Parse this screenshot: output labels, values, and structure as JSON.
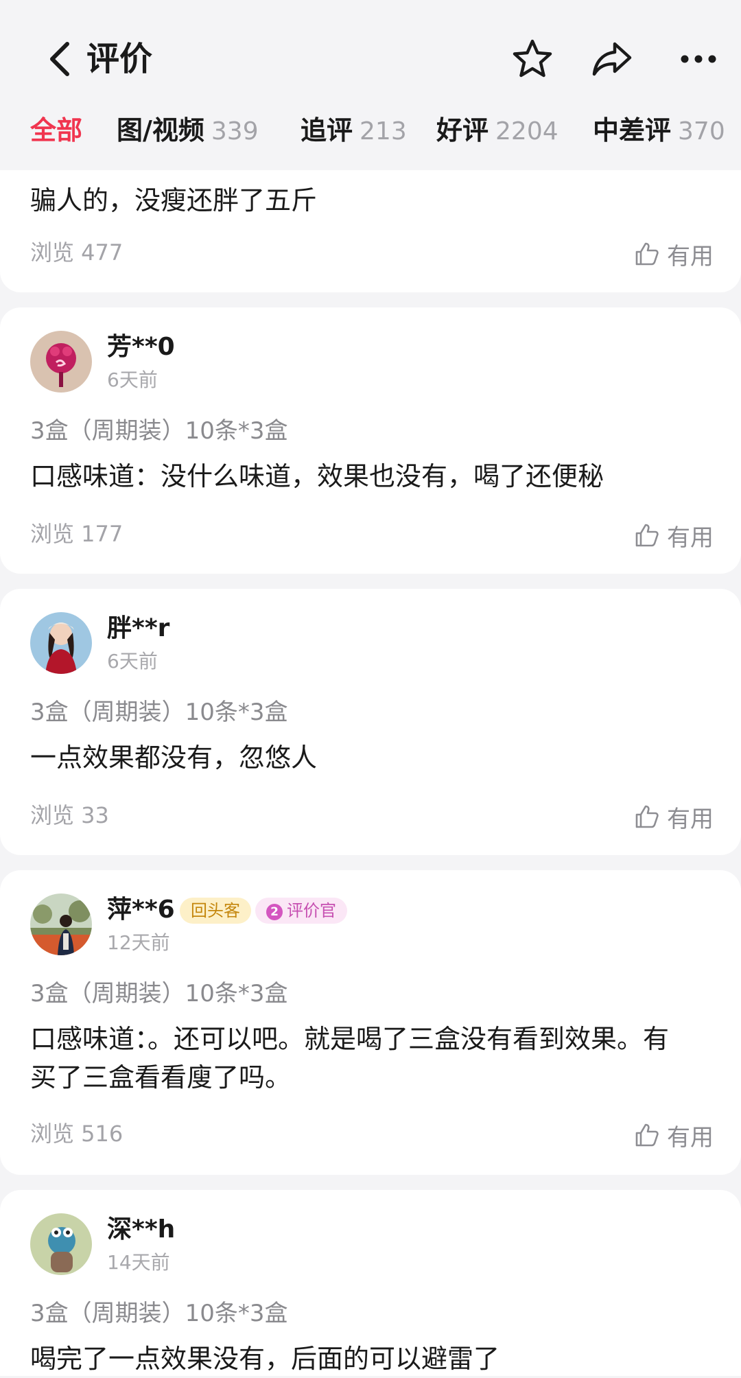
{
  "header": {
    "title": "评价",
    "icons": [
      "back-icon",
      "star-icon",
      "share-icon",
      "more-icon"
    ]
  },
  "tabs": [
    {
      "label": "全部",
      "count": ""
    },
    {
      "label": "图/视频",
      "count": "339"
    },
    {
      "label": "追评",
      "count": "213"
    },
    {
      "label": "好评",
      "count": "2204"
    },
    {
      "label": "中差评",
      "count": "370"
    }
  ],
  "colors": {
    "accent": "#f0354f",
    "background": "#f4f4f6"
  },
  "reviews": [
    {
      "content": "骗人的，没瘦还胖了五斤",
      "views": "浏览 477",
      "useful": "有用"
    },
    {
      "user": "芳**0",
      "time": "6天前",
      "sku": "3盒（周期装）10条*3盒",
      "content": "口感味道：没什么味道，效果也没有，喝了还便秘",
      "views": "浏览 177",
      "useful": "有用"
    },
    {
      "user": "胖**r",
      "time": "6天前",
      "sku": "3盒（周期装）10条*3盒",
      "content": "一点效果都没有，忽悠人",
      "views": "浏览 33",
      "useful": "有用"
    },
    {
      "user": "萍**6",
      "badges": {
        "returning": "回头客",
        "reviewer_level": "2",
        "reviewer": "评价官"
      },
      "time": "12天前",
      "sku": "3盒（周期装）10条*3盒",
      "content_line1": "口感味道：。还可以吧。就是喝了三盒没有看到效果。有",
      "content_line2": "买了三盒看看廋了吗。",
      "views": "浏览 516",
      "useful": "有用"
    },
    {
      "user": "深**h",
      "time": "14天前",
      "sku": "3盒（周期装）10条*3盒",
      "content": "喝完了一点效果没有，后面的可以避雷了"
    }
  ]
}
